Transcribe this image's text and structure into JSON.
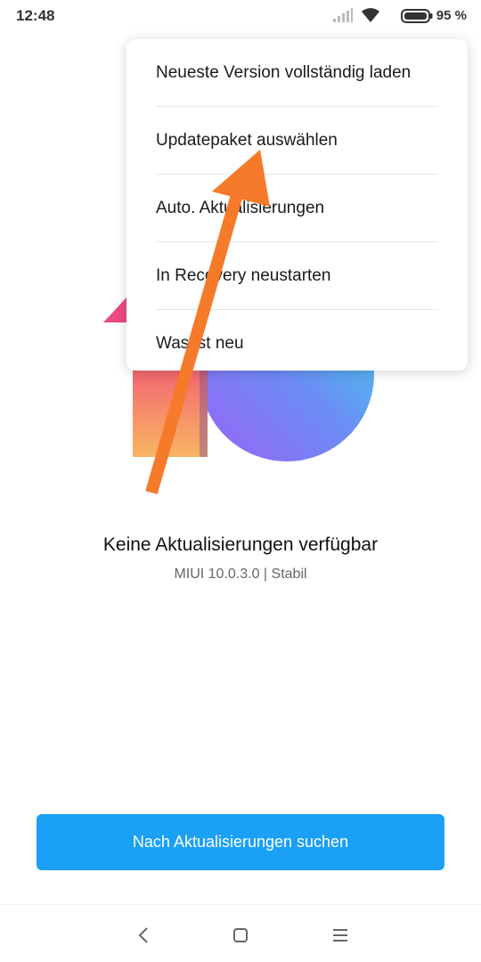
{
  "status_bar": {
    "time": "12:48",
    "battery_text": "95 %",
    "icons": [
      "signal-icon",
      "wifi-icon",
      "battery-icon"
    ]
  },
  "popup_menu": {
    "items": [
      {
        "label": "Neueste Version vollständig laden"
      },
      {
        "label": "Updatepaket auswählen"
      },
      {
        "label": "Auto. Aktualisierungen"
      },
      {
        "label": "In Recovery neustarten"
      },
      {
        "label": "Was ist neu"
      }
    ]
  },
  "main": {
    "status_title": "Keine Aktualisierungen verfügbar",
    "version_text": "MIUI 10.0.3.0 | Stabil",
    "check_button_label": "Nach Aktualisierungen suchen"
  },
  "nav_bar": {
    "icons": [
      "back-icon",
      "home-icon",
      "menu-icon"
    ]
  },
  "colors": {
    "accent": "#1aa0f5",
    "annotation_arrow": "#f57a2a"
  }
}
